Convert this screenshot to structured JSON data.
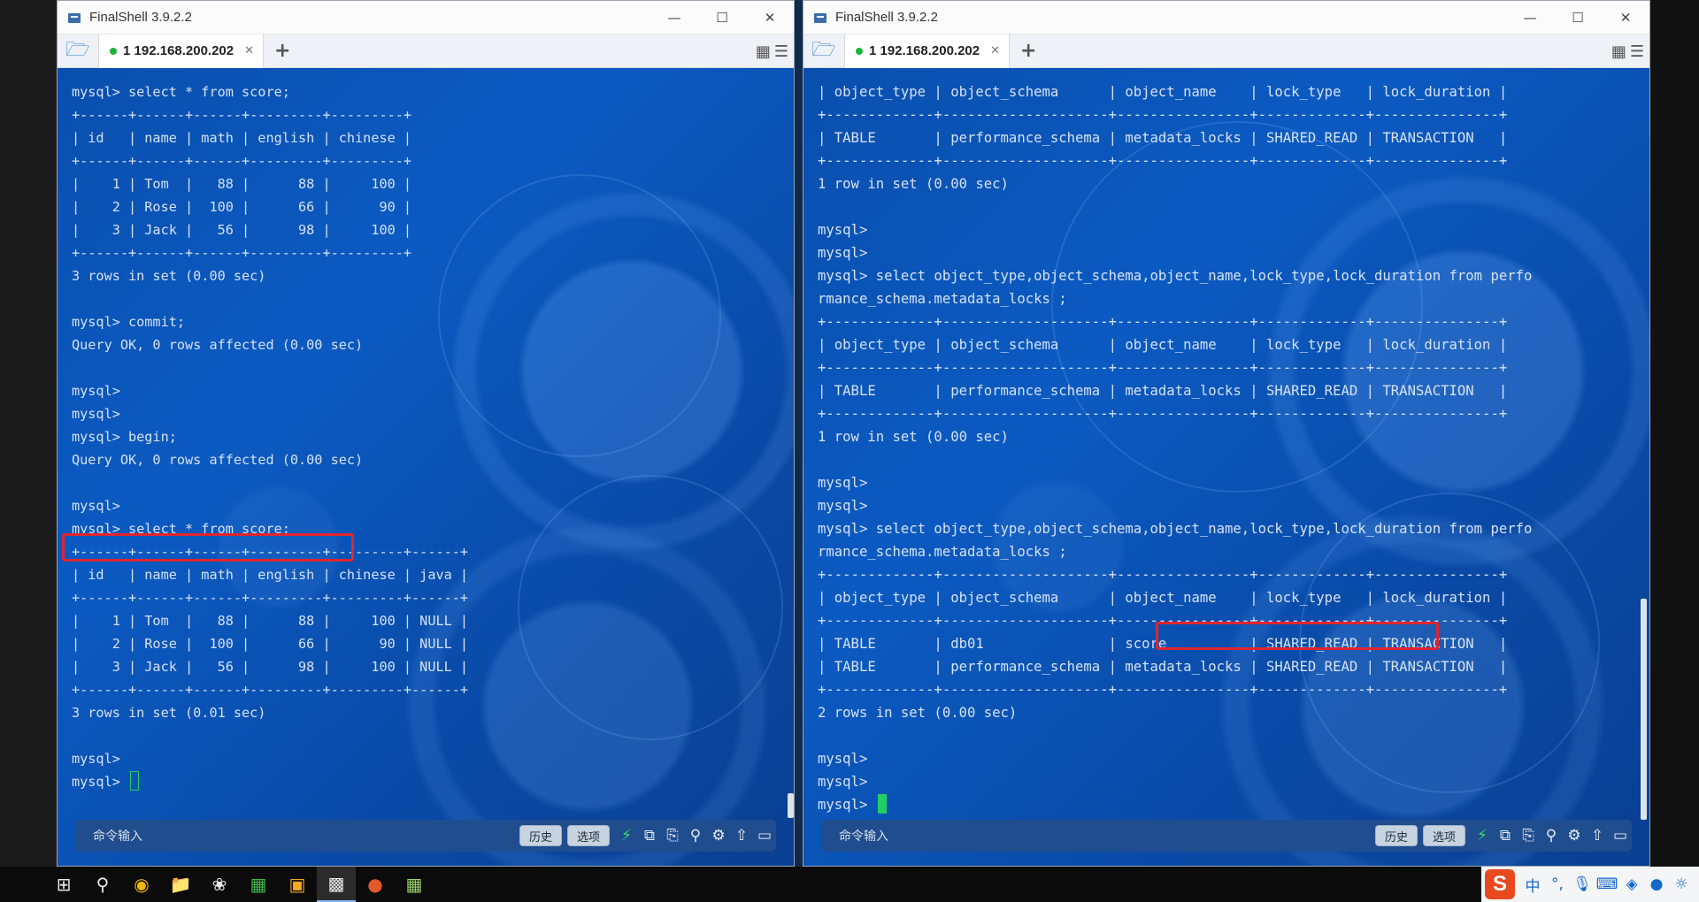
{
  "left_window": {
    "title": "FinalShell 3.9.2.2",
    "tab_label": "1 192.168.200.202",
    "terminal_lines": [
      "mysql> select * from score;",
      "+------+------+------+---------+---------+",
      "| id   | name | math | english | chinese |",
      "+------+------+------+---------+---------+",
      "|    1 | Tom  |   88 |      88 |     100 |",
      "|    2 | Rose |  100 |      66 |      90 |",
      "|    3 | Jack |   56 |      98 |     100 |",
      "+------+------+------+---------+---------+",
      "3 rows in set (0.00 sec)",
      "",
      "mysql> commit;",
      "Query OK, 0 rows affected (0.00 sec)",
      "",
      "mysql>",
      "mysql>",
      "mysql> begin;",
      "Query OK, 0 rows affected (0.00 sec)",
      "",
      "mysql>",
      "mysql> select * from score;",
      "+------+------+------+---------+---------+------+",
      "| id   | name | math | english | chinese | java |",
      "+------+------+------+---------+---------+------+",
      "|    1 | Tom  |   88 |      88 |     100 | NULL |",
      "|    2 | Rose |  100 |      66 |      90 | NULL |",
      "|    3 | Jack |   56 |      98 |     100 | NULL |",
      "+------+------+------+---------+---------+------+",
      "3 rows in set (0.01 sec)",
      "",
      "mysql>",
      "mysql> "
    ],
    "command_placeholder": "命令输入",
    "history_button": "历史",
    "options_button": "选项"
  },
  "right_window": {
    "title": "FinalShell 3.9.2.2",
    "tab_label": "1 192.168.200.202",
    "terminal_lines": [
      "| object_type | object_schema      | object_name    | lock_type   | lock_duration |",
      "+-------------+--------------------+----------------+-------------+---------------+",
      "| TABLE       | performance_schema | metadata_locks | SHARED_READ | TRANSACTION   |",
      "+-------------+--------------------+----------------+-------------+---------------+",
      "1 row in set (0.00 sec)",
      "",
      "mysql>",
      "mysql>",
      "mysql> select object_type,object_schema,object_name,lock_type,lock_duration from perfo",
      "rmance_schema.metadata_locks ;",
      "+-------------+--------------------+----------------+-------------+---------------+",
      "| object_type | object_schema      | object_name    | lock_type   | lock_duration |",
      "+-------------+--------------------+----------------+-------------+---------------+",
      "| TABLE       | performance_schema | metadata_locks | SHARED_READ | TRANSACTION   |",
      "+-------------+--------------------+----------------+-------------+---------------+",
      "1 row in set (0.00 sec)",
      "",
      "mysql>",
      "mysql>",
      "mysql> select object_type,object_schema,object_name,lock_type,lock_duration from perfo",
      "rmance_schema.metadata_locks ;",
      "+-------------+--------------------+----------------+-------------+---------------+",
      "| object_type | object_schema      | object_name    | lock_type   | lock_duration |",
      "+-------------+--------------------+----------------+-------------+---------------+",
      "| TABLE       | db01               | score          | SHARED_READ | TRANSACTION   |",
      "| TABLE       | performance_schema | metadata_locks | SHARED_READ | TRANSACTION   |",
      "+-------------+--------------------+----------------+-------------+---------------+",
      "2 rows in set (0.00 sec)",
      "",
      "mysql>",
      "mysql>",
      "mysql> "
    ],
    "command_placeholder": "命令输入",
    "history_button": "历史",
    "options_button": "选项"
  },
  "colors": {
    "terminal_bg": "#0b5ac2",
    "terminal_text": "#d6e2f2",
    "highlight": "#e0252f",
    "cursor": "#22cc66"
  },
  "icons": {
    "tab_bar": [
      "folder-open-icon",
      "layout-grid-icon",
      "menu-icon"
    ],
    "command_bar": [
      "lightning-icon",
      "copy-icon",
      "paste-icon",
      "search-icon",
      "gear-icon",
      "upload-icon",
      "window-icon"
    ],
    "taskbar": [
      "windows-start-icon",
      "search-icon",
      "chrome-icon",
      "file-explorer-icon",
      "app-icon",
      "excel-icon",
      "app-icon",
      "finalshell-icon",
      "powerpoint-icon",
      "app-icon"
    ],
    "tray": [
      "sogou-icon",
      "ime-chinese-icon",
      "punctuation-icon",
      "microphone-icon",
      "keyboard-icon",
      "shirt-icon",
      "gamepad-icon",
      "bulb-icon"
    ]
  },
  "tray": {
    "ime_label": "中"
  }
}
